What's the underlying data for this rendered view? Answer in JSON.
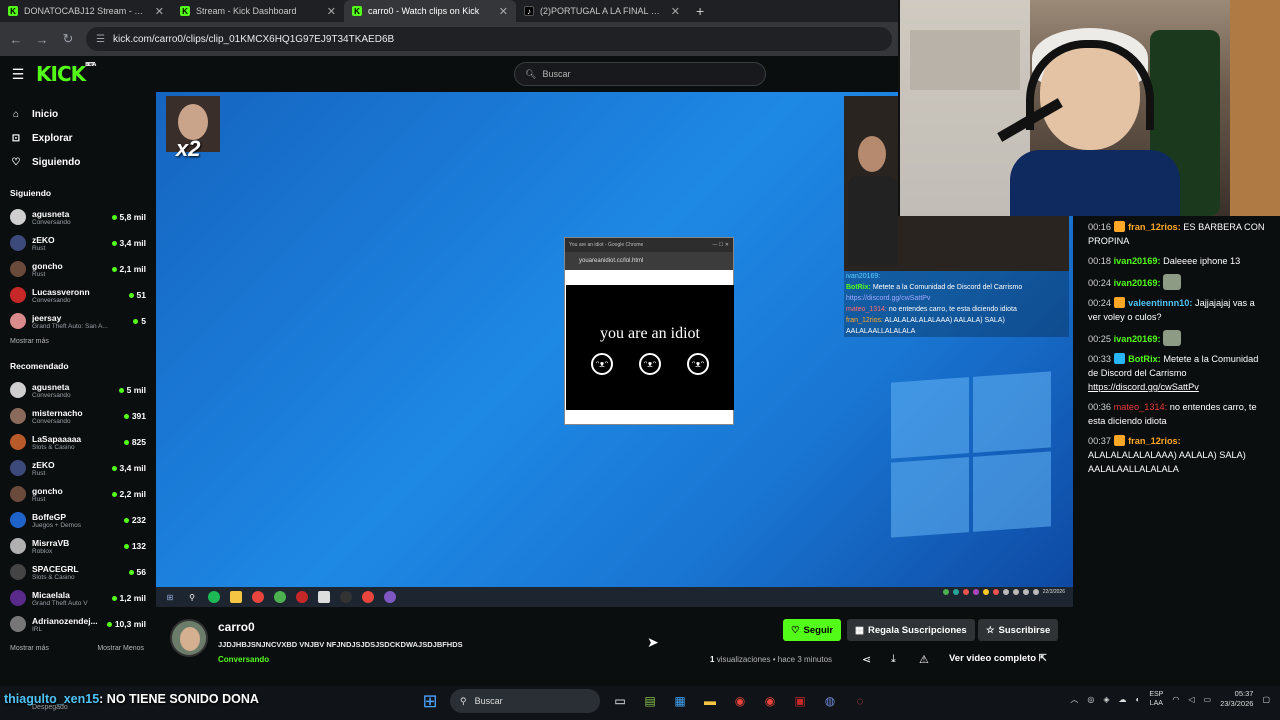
{
  "browser": {
    "tabs": [
      {
        "label": "DONATOCABJ12 Stream - Watc",
        "icon": "kick",
        "active": false
      },
      {
        "label": "Stream - Kick Dashboard",
        "icon": "kick",
        "active": false
      },
      {
        "label": "carro0 - Watch clips on Kick",
        "icon": "kick",
        "active": true
      },
      {
        "label": "(2)PORTUGAL A LA FINAL CON",
        "icon": "tiktok",
        "active": false
      }
    ],
    "url": "kick.com/carro0/clips/clip_01KMCX6HQ1G97EJ9T34TKAED6B"
  },
  "kick": {
    "logo": "KICK",
    "logo_badge": "BETA",
    "search_placeholder": "Buscar"
  },
  "sidebar": {
    "nav": [
      {
        "label": "Inicio",
        "icon": "home-icon"
      },
      {
        "label": "Explorar",
        "icon": "compass-icon"
      },
      {
        "label": "Siguiendo",
        "icon": "heart-icon"
      }
    ],
    "following_title": "Siguiendo",
    "following": [
      {
        "name": "agusneta",
        "category": "Conversando",
        "viewers": "5,8 mil",
        "color": "#cfcfcf"
      },
      {
        "name": "zEKO",
        "category": "Rust",
        "viewers": "3,4 mil",
        "color": "#3b4a7a"
      },
      {
        "name": "goncho",
        "category": "Rust",
        "viewers": "2,1 mil",
        "color": "#6a4a3a"
      },
      {
        "name": "Lucassveronn",
        "category": "Conversando",
        "viewers": "51",
        "color": "#c62828"
      },
      {
        "name": "jeersay",
        "category": "Grand Theft Auto: San A...",
        "viewers": "5",
        "color": "#d98a8a"
      }
    ],
    "show_more": "Mostrar más",
    "recommended_title": "Recomendado",
    "recommended": [
      {
        "name": "agusneta",
        "category": "Conversando",
        "viewers": "5 mil",
        "color": "#cfcfcf"
      },
      {
        "name": "misternacho",
        "category": "Conversando",
        "viewers": "391",
        "color": "#8a6a5a"
      },
      {
        "name": "LaSapaaaaa",
        "category": "Slots & Casino",
        "viewers": "825",
        "color": "#b85a2a"
      },
      {
        "name": "zEKO",
        "category": "Rust",
        "viewers": "3,4 mil",
        "color": "#3b4a7a"
      },
      {
        "name": "goncho",
        "category": "Rust",
        "viewers": "2,2 mil",
        "color": "#6a4a3a"
      },
      {
        "name": "BoffeGP",
        "category": "Juegos + Demos",
        "viewers": "232",
        "color": "#1e63c9"
      },
      {
        "name": "MisrraVB",
        "category": "Roblox",
        "viewers": "132",
        "color": "#b0b0b0"
      },
      {
        "name": "SPACEGRL",
        "category": "Slots & Casino",
        "viewers": "56",
        "color": "#444"
      },
      {
        "name": "Micaelala",
        "category": "Grand Theft Auto V",
        "viewers": "1,2 mil",
        "color": "#5a2a8a"
      },
      {
        "name": "Adrianozendej...",
        "category": "IRL",
        "viewers": "10,3 mil",
        "color": "#777"
      }
    ],
    "show_more_2": "Mostrar más",
    "show_less": "Mostrar Menos"
  },
  "video": {
    "multiplier": "x2",
    "popup_title": "You are an idiot - Google Chrome",
    "popup_url": "youareanidiot.cc/lol.html",
    "popup_text": "you are an idiot",
    "taskbar_date": "22/3/2026",
    "overlay_chat": [
      {
        "user": "ivan20169:",
        "text": "",
        "ucolor": "blue"
      },
      {
        "user": "BotRix:",
        "text": "Metete a la Comunidad de Discord del Carrismo",
        "link": "https://discord.gg/cwSattPv",
        "ucolor": "green"
      },
      {
        "user": "mateo_1314:",
        "text": "no entendes carro, te esta diciendo idiota",
        "ucolor": "red"
      },
      {
        "user": "fran_12rios:",
        "text": "ALALALALALALAAA) AALALA) SALA) AALALAALLALALALA",
        "ucolor": "orange"
      }
    ]
  },
  "chat": {
    "messages": [
      {
        "time": "00:16",
        "user": "fran_12rios:",
        "text": "ES BARBERA CON PROPINA",
        "ucolor": "orange",
        "badge": "#ffa726"
      },
      {
        "time": "00:18",
        "user": "ivan20169:",
        "text": "Daleeee iphone 13",
        "ucolor": "green",
        "badge": ""
      },
      {
        "time": "00:24",
        "user": "ivan20169:",
        "text": "",
        "ucolor": "green",
        "badge": "",
        "emote": true
      },
      {
        "time": "00:24",
        "user": "valeentinnn10:",
        "text": "Jajjajajaj vas a ver voley o culos?",
        "ucolor": "blue",
        "badge": "#ffa726"
      },
      {
        "time": "00:25",
        "user": "ivan20169:",
        "text": "",
        "ucolor": "green",
        "badge": "",
        "emote": true
      },
      {
        "time": "00:33",
        "user": "BotRix:",
        "text": "Metete a la Comunidad de Discord del Carrismo",
        "link": "https://discord.gg/cwSattPv",
        "ucolor": "green",
        "badge": "#29b6f6"
      },
      {
        "time": "00:36",
        "user": "mateo_1314:",
        "text": "no entendes carro, te esta diciendo idiota",
        "ucolor": "red",
        "badge": ""
      },
      {
        "time": "00:37",
        "user": "fran_12rios:",
        "text": "ALALALALALALAAA) AALALA) SALA) AALALAALLALALALA",
        "ucolor": "orange",
        "badge": "#ffa726"
      }
    ]
  },
  "info": {
    "channel": "carro0",
    "clip_title": "JJDJHBJSNJNCVXBD VNJBV NFJNDJSJDSJSDCKDWAJSDJBFHDS",
    "category": "Conversando",
    "follow": "Seguir",
    "gift": "Regala Suscripciones",
    "subscribe": "Suscribirse",
    "views_count": "1",
    "views_label": "visualizaciones",
    "time_ago": "• hace 3 minutos",
    "full_video": "Ver video completo"
  },
  "bottom": {
    "overlay_user": "thiagulto_xen15",
    "overlay_text": ": NO TIENE SONIDO DONA",
    "sub_text": "Despegado",
    "win_search": "Buscar",
    "lang_top": "ESP",
    "lang_bottom": "LAA",
    "time": "05:37",
    "date": "23/3/2026"
  }
}
